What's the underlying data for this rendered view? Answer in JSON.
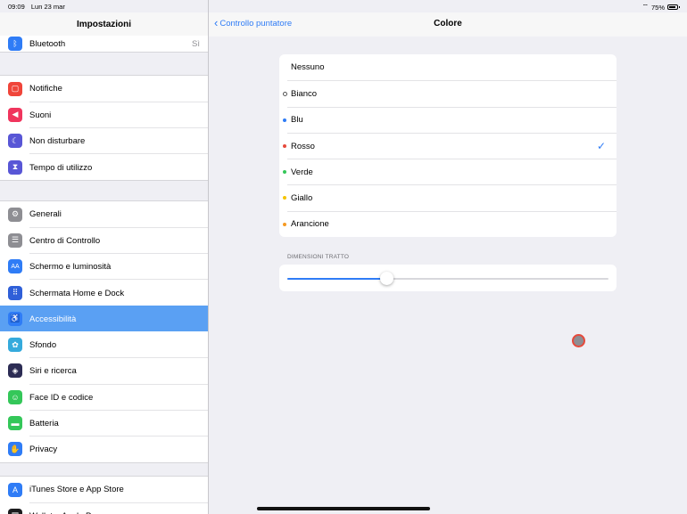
{
  "status_bar": {
    "time": "09:09",
    "date": "Lun 23 mar",
    "battery": "75%"
  },
  "sidebar": {
    "title": "Impostazioni",
    "groups": [
      [
        {
          "label": "Bluetooth",
          "value": "Sì",
          "icon": "bluetooth-icon",
          "color": "#2f7cf6",
          "glyph": "ᛒ"
        }
      ],
      [
        {
          "label": "Notifiche",
          "icon": "notifications-icon",
          "color": "#f0453a",
          "glyph": "▢"
        },
        {
          "label": "Suoni",
          "icon": "sounds-icon",
          "color": "#f0355d",
          "glyph": "◀"
        },
        {
          "label": "Non disturbare",
          "icon": "moon-icon",
          "color": "#5856d6",
          "glyph": "☾"
        },
        {
          "label": "Tempo di utilizzo",
          "icon": "hourglass-icon",
          "color": "#5856d6",
          "glyph": "⧗"
        }
      ],
      [
        {
          "label": "Generali",
          "icon": "gear-icon",
          "color": "#8e8e93",
          "glyph": "⚙"
        },
        {
          "label": "Centro di Controllo",
          "icon": "control-center-icon",
          "color": "#8e8e93",
          "glyph": "☰"
        },
        {
          "label": "Schermo e luminosità",
          "icon": "display-icon",
          "color": "#2f7cf6",
          "glyph": "AA"
        },
        {
          "label": "Schermata Home e Dock",
          "icon": "home-dock-icon",
          "color": "#2f5fd8",
          "glyph": "⠿"
        },
        {
          "label": "Accessibilità",
          "icon": "accessibility-icon",
          "color": "#2f7cf6",
          "glyph": "♿",
          "selected": true
        },
        {
          "label": "Sfondo",
          "icon": "wallpaper-icon",
          "color": "#35aadc",
          "glyph": "✿"
        },
        {
          "label": "Siri e ricerca",
          "icon": "siri-icon",
          "color": "#2c2c54",
          "glyph": "◈"
        },
        {
          "label": "Face ID e codice",
          "icon": "face-id-icon",
          "color": "#34c759",
          "glyph": "☺"
        },
        {
          "label": "Batteria",
          "icon": "battery-icon",
          "color": "#34c759",
          "glyph": "▬"
        },
        {
          "label": "Privacy",
          "icon": "privacy-hand-icon",
          "color": "#2f7cf6",
          "glyph": "✋"
        }
      ],
      [
        {
          "label": "iTunes Store e App Store",
          "icon": "app-store-icon",
          "color": "#2f7cf6",
          "glyph": "A"
        },
        {
          "label": "Wallet e Apple Pay",
          "icon": "wallet-icon",
          "color": "#1c1c1e",
          "glyph": "▤"
        }
      ]
    ]
  },
  "detail": {
    "back_label": "Controllo puntatore",
    "title": "Colore",
    "colors": [
      {
        "label": "Nessuno",
        "dot": null,
        "selected": false
      },
      {
        "label": "Bianco",
        "dot": "#ffffff",
        "selected": false
      },
      {
        "label": "Blu",
        "dot": "#2f7cf6",
        "selected": false
      },
      {
        "label": "Rosso",
        "dot": "#e64a3c",
        "selected": true
      },
      {
        "label": "Verde",
        "dot": "#34c759",
        "selected": false
      },
      {
        "label": "Giallo",
        "dot": "#f5c400",
        "selected": false
      },
      {
        "label": "Arancione",
        "dot": "#f59a23",
        "selected": false
      }
    ],
    "stroke_section_header": "DIMENSIONI TRATTO",
    "stroke_slider_value": 0.31
  },
  "colors": {
    "accent": "#2f7cf6",
    "selected_row": "#5aa0f3",
    "pointer_fill": "#8e8e93",
    "pointer_stroke": "#e64a3c"
  }
}
